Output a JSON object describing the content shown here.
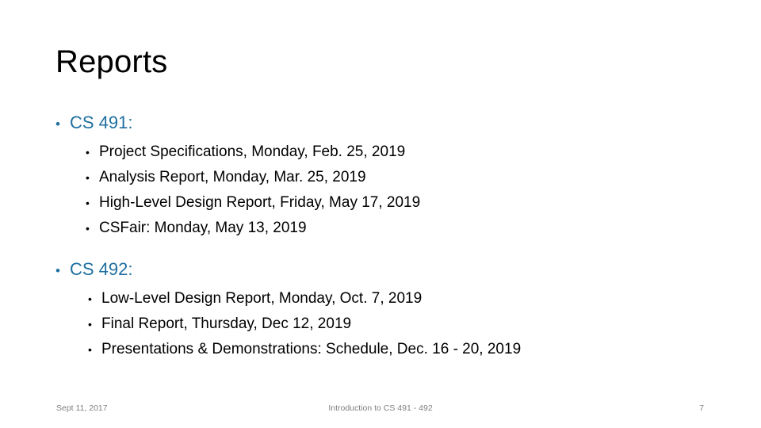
{
  "slide": {
    "title": "Reports",
    "accent_color": "#1F6FA0",
    "text_color": "#000000",
    "background_color": "#FFFFFF",
    "footer_color": "#808080",
    "bullet_glyph_level1": "•",
    "bullet_glyph_level2": "•"
  },
  "groups": [
    {
      "heading": "CS 491:",
      "items": [
        "Project Specifications, Monday, Feb. 25, 2019",
        "Analysis Report, Monday, Mar. 25, 2019",
        "High-Level Design Report, Friday, May 17, 2019",
        "CSFair: Monday, May 13, 2019"
      ]
    },
    {
      "heading": "CS 492:",
      "items": [
        "Low-Level Design Report, Monday, Oct. 7, 2019",
        "Final Report, Thursday, Dec 12, 2019",
        "Presentations & Demonstrations: Schedule, Dec. 16 - 20, 2019"
      ]
    }
  ],
  "footer": {
    "date": "Sept 11, 2017",
    "course": "Introduction to CS 491 - 492",
    "page_number": "7"
  }
}
